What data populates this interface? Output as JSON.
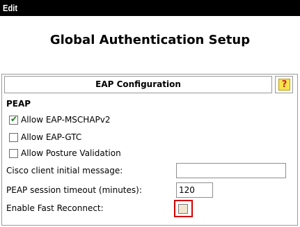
{
  "menu": {
    "edit_label": "Edit"
  },
  "page": {
    "title": "Global Authentication Setup"
  },
  "panel": {
    "header": "EAP Configuration",
    "help_icon": "question-mark-icon",
    "section": "PEAP",
    "options": [
      {
        "label": "Allow EAP-MSCHAPv2",
        "checked": true
      },
      {
        "label": "Allow EAP-GTC",
        "checked": false
      },
      {
        "label": "Allow Posture Validation",
        "checked": false
      }
    ],
    "cisco_message": {
      "label": "Cisco client initial message:",
      "value": ""
    },
    "session_timeout": {
      "label": "PEAP session timeout (minutes):",
      "value": "120"
    },
    "fast_reconnect": {
      "label": "Enable Fast Reconnect:",
      "checked": false
    }
  },
  "colors": {
    "highlight": "#d40000",
    "help_bg": "#f8e44a",
    "check": "#1a7a1a"
  }
}
